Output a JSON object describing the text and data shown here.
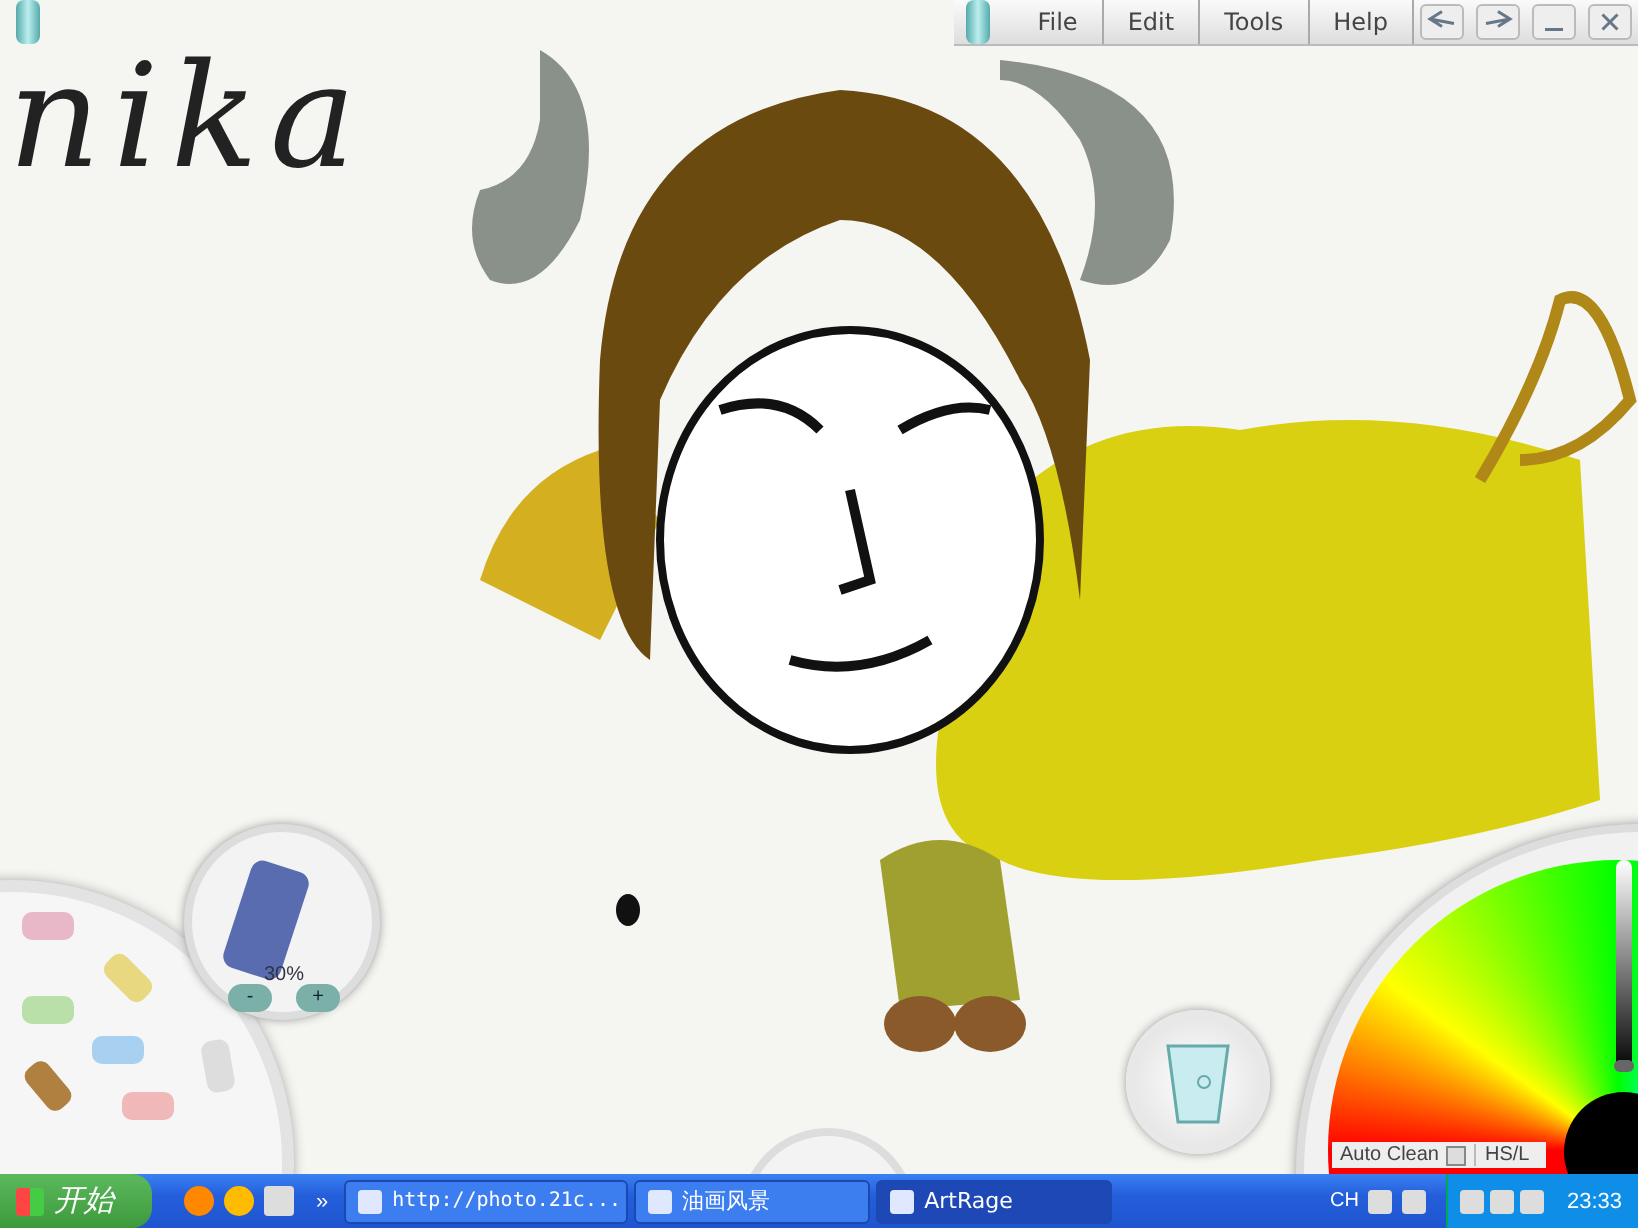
{
  "canvas": {
    "caption": "nika"
  },
  "menu": [
    {
      "label": "File"
    },
    {
      "label": "Edit"
    },
    {
      "label": "Tools"
    },
    {
      "label": "Help"
    }
  ],
  "brush_size": {
    "reading": "30%",
    "minus": "-",
    "plus": "+"
  },
  "color_picker": {
    "auto_clean": {
      "label": "Auto Clean",
      "checked": false
    },
    "mode": "HS/L",
    "lightness": {
      "level": 0.0
    }
  },
  "taskbar": {
    "start": "开始",
    "more": "»",
    "tasks": [
      {
        "label": "http://photo.21c...",
        "selected": false
      },
      {
        "label": "油画风景",
        "selected": false
      },
      {
        "label": "ArtRage",
        "selected": true
      }
    ],
    "language": "CH",
    "clock": "23:33"
  }
}
